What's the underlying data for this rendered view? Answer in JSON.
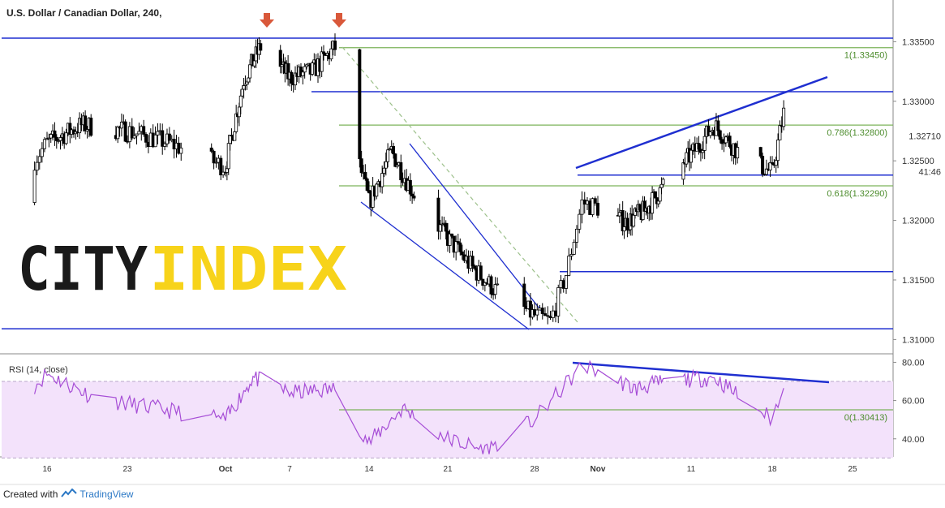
{
  "chart_data": {
    "type": "candlestick",
    "title": "U.S. Dollar / Canadian Dollar, 240,",
    "price_axis": {
      "ticks": [
        "1.33500",
        "1.33000",
        "1.32710",
        "1.32500",
        "1.32000",
        "1.31500",
        "1.31000"
      ],
      "ylim": [
        1.3088,
        1.3385
      ],
      "badges": [
        {
          "label": "1.32710",
          "value": 1.3271
        },
        {
          "label": "41:46",
          "value": 1.3241
        }
      ]
    },
    "date_axis": {
      "ticks": [
        "16",
        "23",
        "Oct",
        "7",
        "14",
        "21",
        "28",
        "Nov",
        "11",
        "18",
        "25"
      ],
      "month_ticks": [
        "Oct",
        "Nov"
      ]
    },
    "fibonacci": [
      {
        "label": "1(1.33450)",
        "value": 1.3345
      },
      {
        "label": "0.786(1.32800)",
        "value": 1.328
      },
      {
        "label": "0.618(1.32290)",
        "value": 1.3229
      },
      {
        "label": "0(1.30413)",
        "value": 1.3041
      }
    ],
    "horizontal_levels": [
      1.3353,
      1.3308,
      1.3238,
      1.3157,
      1.3109
    ],
    "price_series_approx": [
      {
        "date": "Sep 13",
        "close": 1.3215
      },
      {
        "date": "Sep 16",
        "close": 1.3265
      },
      {
        "date": "Sep 19",
        "close": 1.328
      },
      {
        "date": "Sep 23",
        "close": 1.3275
      },
      {
        "date": "Sep 26",
        "close": 1.3265
      },
      {
        "date": "Sep 30",
        "close": 1.3245
      },
      {
        "date": "Oct 2",
        "close": 1.3318
      },
      {
        "date": "Oct 4",
        "close": 1.3348
      },
      {
        "date": "Oct 7",
        "close": 1.332
      },
      {
        "date": "Oct 9",
        "close": 1.3325
      },
      {
        "date": "Oct 11",
        "close": 1.3345
      },
      {
        "date": "Oct 12",
        "close": 1.329
      },
      {
        "date": "Oct 14",
        "close": 1.3215
      },
      {
        "date": "Oct 16",
        "close": 1.3258
      },
      {
        "date": "Oct 18",
        "close": 1.3222
      },
      {
        "date": "Oct 21",
        "close": 1.3185
      },
      {
        "date": "Oct 23",
        "close": 1.316
      },
      {
        "date": "Oct 25",
        "close": 1.314
      },
      {
        "date": "Oct 28",
        "close": 1.312
      },
      {
        "date": "Oct 29",
        "close": 1.3115
      },
      {
        "date": "Oct 30",
        "close": 1.3155
      },
      {
        "date": "Oct 31",
        "close": 1.3215
      },
      {
        "date": "Nov 4",
        "close": 1.3198
      },
      {
        "date": "Nov 6",
        "close": 1.3208
      },
      {
        "date": "Nov 8",
        "close": 1.3228
      },
      {
        "date": "Nov 11",
        "close": 1.3255
      },
      {
        "date": "Nov 13",
        "close": 1.328
      },
      {
        "date": "Nov 15",
        "close": 1.3258
      },
      {
        "date": "Nov 18",
        "close": 1.324
      },
      {
        "date": "Nov 19",
        "close": 1.329
      }
    ],
    "rsi": {
      "label": "RSI (14, close)",
      "ticks": [
        "80.00",
        "60.00",
        "40.00"
      ],
      "ylim": [
        31,
        84
      ],
      "band": [
        30,
        70
      ],
      "series_approx": [
        {
          "date": "Sep 13",
          "value": 52
        },
        {
          "date": "Sep 16",
          "value": 74
        },
        {
          "date": "Sep 20",
          "value": 62
        },
        {
          "date": "Sep 25",
          "value": 56
        },
        {
          "date": "Sep 30",
          "value": 50
        },
        {
          "date": "Oct 3",
          "value": 72
        },
        {
          "date": "Oct 7",
          "value": 64
        },
        {
          "date": "Oct 11",
          "value": 66
        },
        {
          "date": "Oct 14",
          "value": 38
        },
        {
          "date": "Oct 17",
          "value": 56
        },
        {
          "date": "Oct 21",
          "value": 40
        },
        {
          "date": "Oct 24",
          "value": 34
        },
        {
          "date": "Oct 28",
          "value": 50
        },
        {
          "date": "Oct 31",
          "value": 78
        },
        {
          "date": "Nov 5",
          "value": 66
        },
        {
          "date": "Nov 8",
          "value": 70
        },
        {
          "date": "Nov 13",
          "value": 72
        },
        {
          "date": "Nov 18",
          "value": 50
        },
        {
          "date": "Nov 19",
          "value": 70
        }
      ]
    }
  },
  "watermark": {
    "part1": "CITY",
    "part2": "INDEX"
  },
  "footer": {
    "created_with": "Created with",
    "brand": "TradingView"
  },
  "colors": {
    "up_candle": "#ffffff",
    "down_candle": "#000000",
    "fib": "#7cb35a",
    "trendline": "#1f2fd0",
    "rsi_line": "#a64dd6",
    "rsi_band": "#f3e2fb",
    "arrow": "#d9583a",
    "watermark_dark": "#1a1a1a",
    "watermark_yellow": "#f7d31a"
  }
}
